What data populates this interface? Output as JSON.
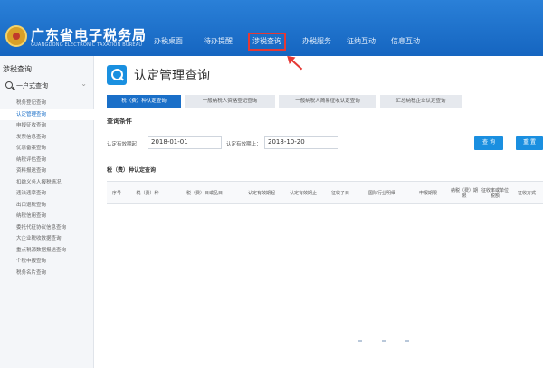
{
  "header": {
    "title": "广东省电子税务局",
    "subtitle": "GUANGDONG ELECTRONIC TAXATION BUREAU",
    "nav": [
      {
        "label": "办税桌面",
        "active": false
      },
      {
        "label": "待办提醒",
        "active": false
      },
      {
        "label": "涉税查询",
        "active": true
      },
      {
        "label": "办税服务",
        "active": false
      },
      {
        "label": "征纳互动",
        "active": false
      },
      {
        "label": "信息互动",
        "active": false
      }
    ]
  },
  "sidebar": {
    "header": "涉税查询",
    "group_label": "一户式查询",
    "items": [
      {
        "label": "税务登记查询",
        "active": false
      },
      {
        "label": "认定管理查询",
        "active": true
      },
      {
        "label": "申报征收查询",
        "active": false
      },
      {
        "label": "发票信息查询",
        "active": false
      },
      {
        "label": "优惠备案查询",
        "active": false
      },
      {
        "label": "纳税评估查询",
        "active": false
      },
      {
        "label": "资料报送查询",
        "active": false
      },
      {
        "label": "扣缴义务人报税情况",
        "active": false
      },
      {
        "label": "违法违章查询",
        "active": false
      },
      {
        "label": "出口退税查询",
        "active": false
      },
      {
        "label": "纳税信用查询",
        "active": false
      },
      {
        "label": "委托代征协议信息查询",
        "active": false
      },
      {
        "label": "大企业税收数据查询",
        "active": false
      },
      {
        "label": "重点税源数据报送查询",
        "active": false
      },
      {
        "label": "个税申报查询",
        "active": false
      },
      {
        "label": "税务名片查询",
        "active": false
      }
    ]
  },
  "main": {
    "page_title": "认定管理查询",
    "tabs": [
      {
        "label": "税（费）种认定查询",
        "active": true
      },
      {
        "label": "一般纳税人资格登记查询",
        "active": false
      },
      {
        "label": "一般纳税人简易征收认定查询",
        "active": false
      },
      {
        "label": "汇总纳税企业认定查询",
        "active": false
      }
    ],
    "query_section": "查询条件",
    "start_label": "认定有效期起：",
    "start_value": "2018-01-01",
    "end_label": "认定有效期止：",
    "end_value": "2018-10-20",
    "query_button": "查 询",
    "reset_button": "重 置",
    "result_section": "税（费）种认定查询",
    "columns": [
      "序号",
      "税（费）种",
      "税（费）目或品目",
      "认定有效期起",
      "认定有效期止",
      "征收子目",
      "国际行业明细",
      "申报期限",
      "纳税（费）期限",
      "征收率或单位税额",
      "征收方式"
    ]
  },
  "colors": {
    "brand_blue": "#1a6fc8",
    "highlight_red": "#e53935",
    "button_blue": "#1a8fe0"
  },
  "icons": {
    "logo": "tax-emblem-icon",
    "search": "search-icon",
    "chevron": "chevron-down-icon"
  }
}
